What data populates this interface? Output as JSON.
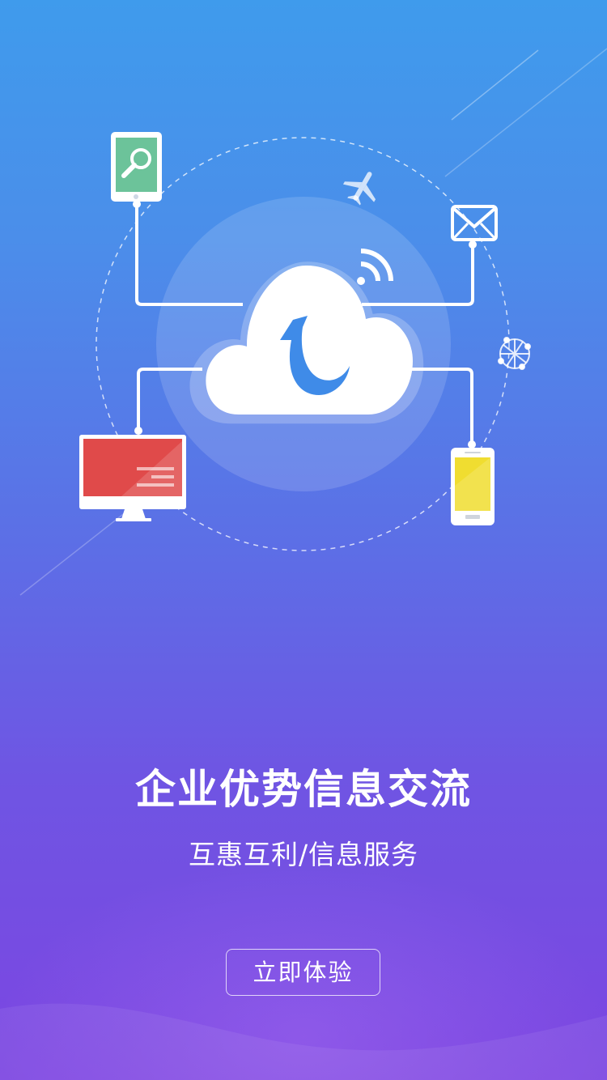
{
  "splash": {
    "headline": "企业优势信息交流",
    "subline": "互惠互利/信息服务",
    "cta_label": "立即体验"
  },
  "illustration": {
    "icons": [
      "tablet-search-icon",
      "airplane-icon",
      "mail-icon",
      "wifi-signal-icon",
      "cloud-upload-icon",
      "globe-icon",
      "desktop-monitor-icon",
      "smartphone-icon"
    ]
  },
  "colors": {
    "gradient_top": "#3f9bec",
    "gradient_bottom": "#7c45e1",
    "tablet_screen": "#6cc39a",
    "monitor_screen": "#e04a4a",
    "phone_screen": "#f0dd30",
    "cloud_arrow": "#3f8be8"
  }
}
